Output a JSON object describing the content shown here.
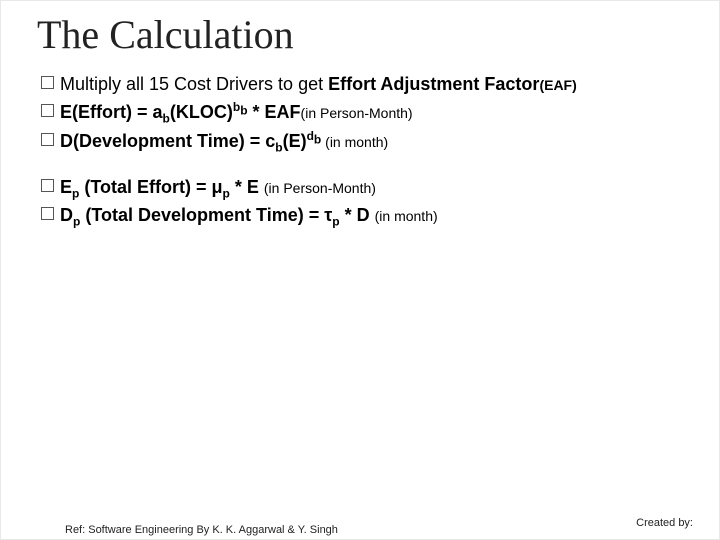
{
  "title": "The Calculation",
  "bullets": {
    "b1_pre": "Multiply all 15 Cost Drivers to get ",
    "b1_bold": "Effort Adjustment Factor",
    "b1_small": "(EAF)",
    "b2_bold1": "E(Effort) = a",
    "b2_sub1": "b",
    "b2_bold2": "(KLOC)",
    "b2_sup1": "b",
    "b2_supsub1": "b",
    "b2_bold3": " * EAF",
    "b2_small1": "(in Person-Month)",
    "b3_bold1": "D(Development Time) = c",
    "b3_sub1": "b",
    "b3_bold2": "(E)",
    "b3_sup1": "d",
    "b3_supsub1": "b",
    "b3_small1": " (in month)",
    "b4_bold1": "E",
    "b4_sub1": "p",
    "b4_bold2": " (Total Effort) = μ",
    "b4_sub2": "p",
    "b4_bold3": " * E ",
    "b4_small1": "(in Person-Month)",
    "b5_bold1": "D",
    "b5_sub1": "p",
    "b5_bold2": " (Total Development Time) = τ",
    "b5_sub2": "p",
    "b5_bold3": " * D ",
    "b5_small1": "(in month)"
  },
  "footer_left": "Ref: Software Engineering By K. K. Aggarwal & Y. Singh",
  "footer_right": "Created by:"
}
